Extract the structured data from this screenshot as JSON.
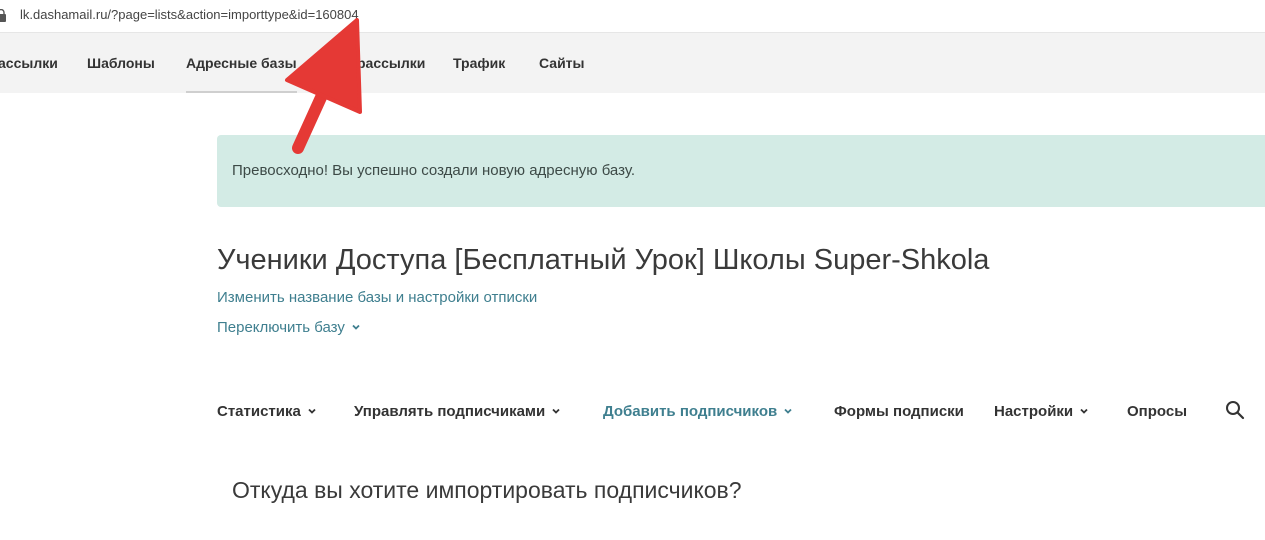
{
  "browser": {
    "url": "lk.dashamail.ru/?page=lists&action=importtype&id=160804"
  },
  "topnav": {
    "items": [
      "ассылки",
      "Шаблоны",
      "Адресные базы",
      "рассылки",
      "Трафик",
      "Сайты"
    ],
    "active": "Адресные базы"
  },
  "alert": {
    "text": "Превосходно! Вы успешно создали новую адресную базу."
  },
  "base": {
    "title": "Ученики Доступа [Бесплатный Урок] Школы Super-Shkola",
    "settings_link": "Изменить название базы и настройки отписки",
    "switch_label": "Переключить базу"
  },
  "subnav": {
    "items": [
      {
        "label": "Статистика"
      },
      {
        "label": "Управлять подписчиками"
      },
      {
        "label": "Добавить подписчиков"
      },
      {
        "label": "Формы подписки"
      },
      {
        "label": "Настройки"
      },
      {
        "label": "Опросы"
      }
    ]
  },
  "main": {
    "heading": "Откуда вы хотите импортировать подписчиков?"
  },
  "colors": {
    "accent": "#3f7f8f",
    "alert_bg": "#d3ebe5",
    "annotation_red": "#e53935"
  },
  "icons": {
    "lock": "lock-icon",
    "chevron": "chevron-down-icon",
    "search": "search-icon",
    "annotation": "red-arrow-annotation"
  }
}
